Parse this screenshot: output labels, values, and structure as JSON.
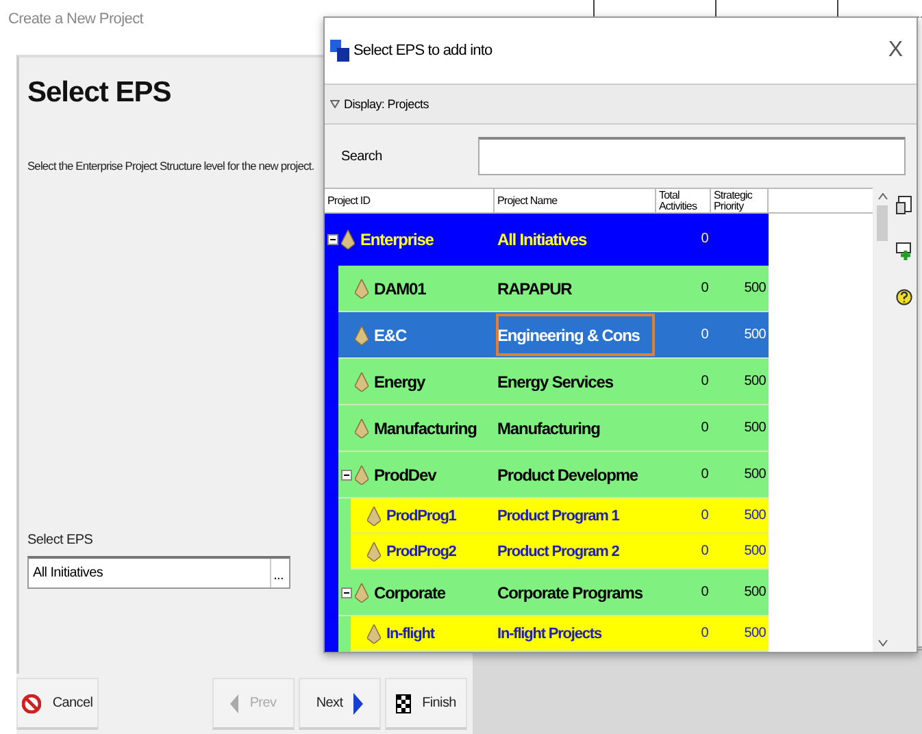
{
  "wizard": {
    "title": "Create a New Project",
    "heading": "Select EPS",
    "description": "Select the Enterprise Project Structure level for the new project.",
    "eps_field": {
      "label": "Select EPS",
      "value": "All Initiatives",
      "button": "..."
    },
    "buttons": [
      {
        "label": "Cancel",
        "kind": "cancel",
        "disabled": false
      },
      {
        "label": "Prev",
        "kind": "prev",
        "disabled": true
      },
      {
        "label": "Next",
        "kind": "next",
        "disabled": false
      },
      {
        "label": "Finish",
        "kind": "finish",
        "disabled": false
      }
    ]
  },
  "dialog": {
    "title": "Select EPS to add into",
    "close": "X",
    "display_bar": "Display: Projects",
    "search": {
      "label": "Search"
    },
    "columns": [
      "Project ID",
      "Project Name",
      "Total Activities",
      "Strategic Priority"
    ],
    "rows": [
      {
        "id": "Enterprise",
        "name": "All Initiatives",
        "activities": "0",
        "selected": false,
        "expanded": true,
        "children": [
          {
            "id": "DAM01",
            "name": "RAPAPUR",
            "activities": "0",
            "priority": "500",
            "selected": false
          },
          {
            "id": "E&C",
            "name": "Engineering & Cons",
            "activities": "0",
            "priority": "500",
            "selected": true
          },
          {
            "id": "Energy",
            "name": "Energy Services",
            "activities": "0",
            "priority": "500",
            "selected": false
          },
          {
            "id": "Manufacturing",
            "name": "Manufacturing",
            "activities": "0",
            "priority": "500",
            "selected": false
          },
          {
            "id": "ProdDev",
            "name": "Product Developme",
            "activities": "0",
            "priority": "500",
            "selected": false,
            "expanded": true,
            "children": [
              {
                "id": "ProdProg1",
                "name": "Product Program 1",
                "activities": "0",
                "priority": "500",
                "selected": false
              },
              {
                "id": "ProdProg2",
                "name": "Product Program 2",
                "activities": "0",
                "priority": "500",
                "selected": false
              }
            ]
          },
          {
            "id": "Corporate",
            "name": "Corporate Programs",
            "activities": "0",
            "priority": "500",
            "selected": false,
            "expanded": true,
            "children": [
              {
                "id": "In-flight",
                "name": "In-flight Projects",
                "activities": "0",
                "priority": "500",
                "selected": false
              }
            ]
          }
        ]
      }
    ]
  }
}
